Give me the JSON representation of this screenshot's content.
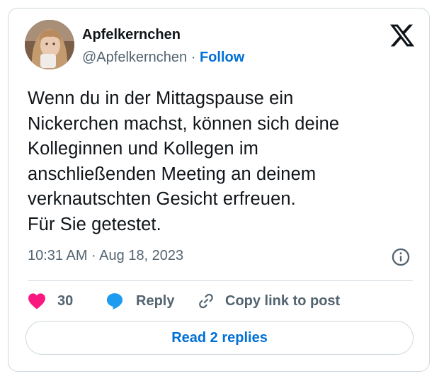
{
  "tweet": {
    "author_name": "Apfelkernchen",
    "handle": "@Apfelkernchen",
    "separator": " · ",
    "follow_label": "Follow",
    "text": "Wenn du in der Mittagspause ein\nNickerchen machst, können sich deine\nKolleginnen und Kollegen im\nanschließenden Meeting an deinem\nverknautschten Gesicht erfreuen.\nFür Sie getestet.",
    "timestamp": "10:31 AM · Aug 18, 2023",
    "like_count": "30",
    "reply_label": "Reply",
    "copy_link_label": "Copy link to post",
    "read_replies_label": "Read 2 replies"
  },
  "icons": {
    "logo": "x-logo-icon",
    "info": "info-icon",
    "like": "heart-icon",
    "reply": "speech-bubble-icon",
    "copy": "link-icon"
  },
  "colors": {
    "text": "#0f1419",
    "secondary": "#536471",
    "link": "#006fd6",
    "heart": "#f91880",
    "reply_bubble": "#1d9bf0",
    "border": "#cfd9de"
  }
}
